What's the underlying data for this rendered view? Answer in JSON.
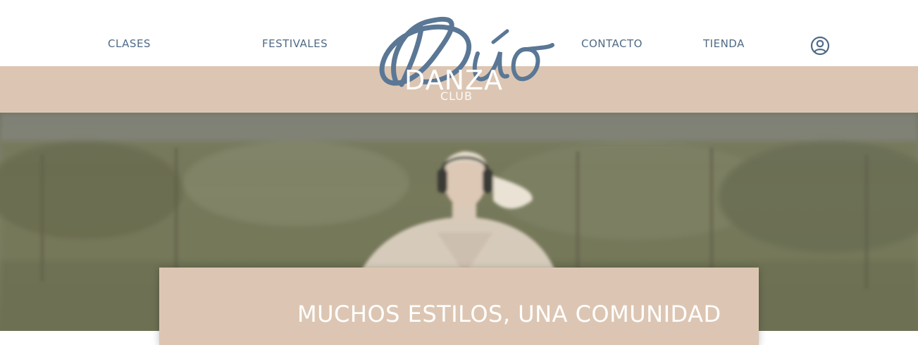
{
  "nav": {
    "clases": "CLASES",
    "festivales": "FESTIVALES",
    "contacto": "CONTACTO",
    "tienda": "TIENDA"
  },
  "logo": {
    "script": "Dúo",
    "main": "DANZA",
    "sub": "CLUB"
  },
  "account": {
    "icon": "user-circle-icon"
  },
  "hero": {
    "headline": "MUCHOS ESTILOS, UNA COMUNIDAD"
  },
  "colors": {
    "nav_text": "#4f6a86",
    "beige": "#dcc6b3",
    "logo_script": "#5a7795"
  }
}
